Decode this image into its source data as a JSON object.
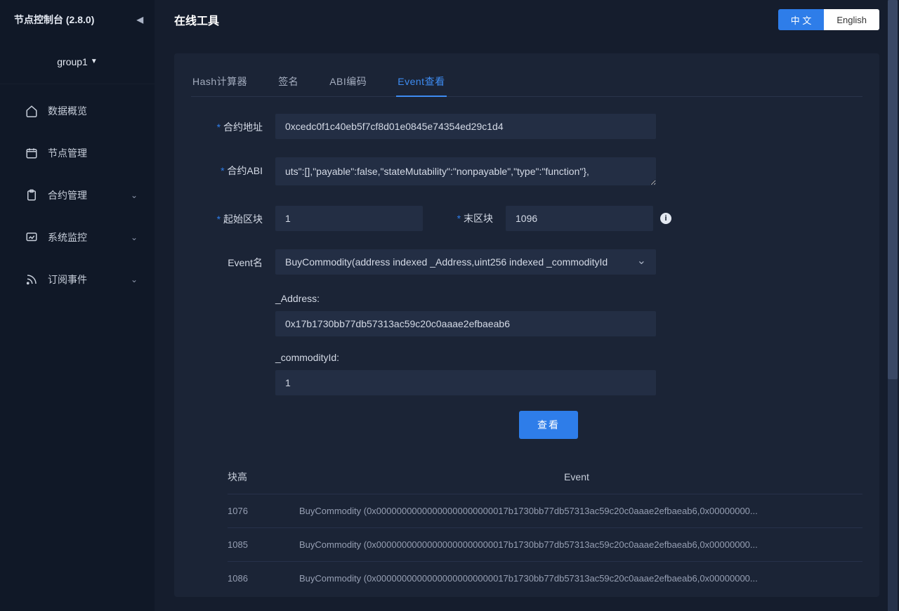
{
  "brand": "节点控制台 (2.8.0)",
  "group": "group1",
  "nav": {
    "items": [
      {
        "label": "数据概览",
        "expandable": false
      },
      {
        "label": "节点管理",
        "expandable": false
      },
      {
        "label": "合约管理",
        "expandable": true
      },
      {
        "label": "系统监控",
        "expandable": true
      },
      {
        "label": "订阅事件",
        "expandable": true
      }
    ]
  },
  "page_title": "在线工具",
  "lang": {
    "zh": "中 文",
    "en": "English"
  },
  "tabs": {
    "items": [
      "Hash计算器",
      "签名",
      "ABI编码",
      "Event查看"
    ],
    "active": "Event查看"
  },
  "form": {
    "contract_address_label": "合约地址",
    "contract_address_value": "0xcedc0f1c40eb5f7cf8d01e0845e74354ed29c1d4",
    "contract_abi_label": "合约ABI",
    "contract_abi_value": "uts\":[],\"payable\":false,\"stateMutability\":\"nonpayable\",\"type\":\"function\"},",
    "start_block_label": "起始区块",
    "start_block_value": "1",
    "end_block_label": "末区块",
    "end_block_value": "1096",
    "event_label": "Event名",
    "event_value": "BuyCommodity(address indexed _Address,uint256 indexed _commodityId",
    "param_address_label": "_Address:",
    "param_address_value": "0x17b1730bb77db57313ac59c20c0aaae2efbaeab6",
    "param_commodity_label": "_commodityId:",
    "param_commodity_value": "1",
    "submit": "查看"
  },
  "table": {
    "headers": {
      "block": "块高",
      "event": "Event"
    },
    "rows": [
      {
        "block": "1076",
        "event": "BuyCommodity (0x00000000000000000000000017b1730bb77db57313ac59c20c0aaae2efbaeab6,0x00000000..."
      },
      {
        "block": "1085",
        "event": "BuyCommodity (0x00000000000000000000000017b1730bb77db57313ac59c20c0aaae2efbaeab6,0x00000000..."
      },
      {
        "block": "1086",
        "event": "BuyCommodity (0x00000000000000000000000017b1730bb77db57313ac59c20c0aaae2efbaeab6,0x00000000..."
      }
    ]
  }
}
